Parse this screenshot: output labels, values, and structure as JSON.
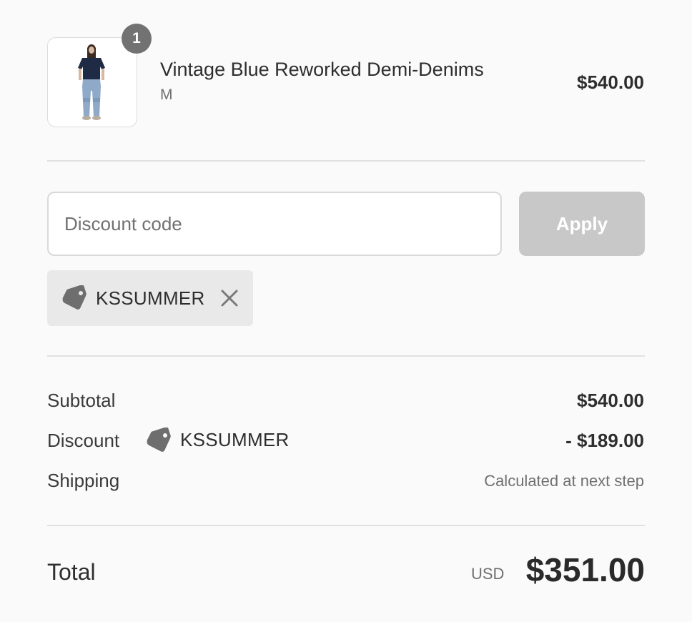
{
  "product": {
    "quantity": "1",
    "name": "Vintage Blue Reworked Demi-Denims",
    "variant": "M",
    "price": "$540.00",
    "image_alt": "Model wearing navy tee and light blue reworked jeans"
  },
  "discount_form": {
    "placeholder": "Discount code",
    "apply_label": "Apply",
    "applied_code": "KSSUMMER",
    "applied_icon": "tag-icon",
    "remove_icon": "close-icon"
  },
  "totals": {
    "subtotal_label": "Subtotal",
    "subtotal_value": "$540.00",
    "discount_label": "Discount",
    "discount_code": "KSSUMMER",
    "discount_value": "- $189.00",
    "shipping_label": "Shipping",
    "shipping_value": "Calculated at next step",
    "total_label": "Total",
    "currency": "USD",
    "total_value": "$351.00"
  },
  "colors": {
    "background": "#fafafa",
    "badge": "#727272",
    "apply_disabled": "#c8c8c8",
    "tag_background": "#e9e9e9",
    "tag_icon": "#6e6e6e"
  }
}
